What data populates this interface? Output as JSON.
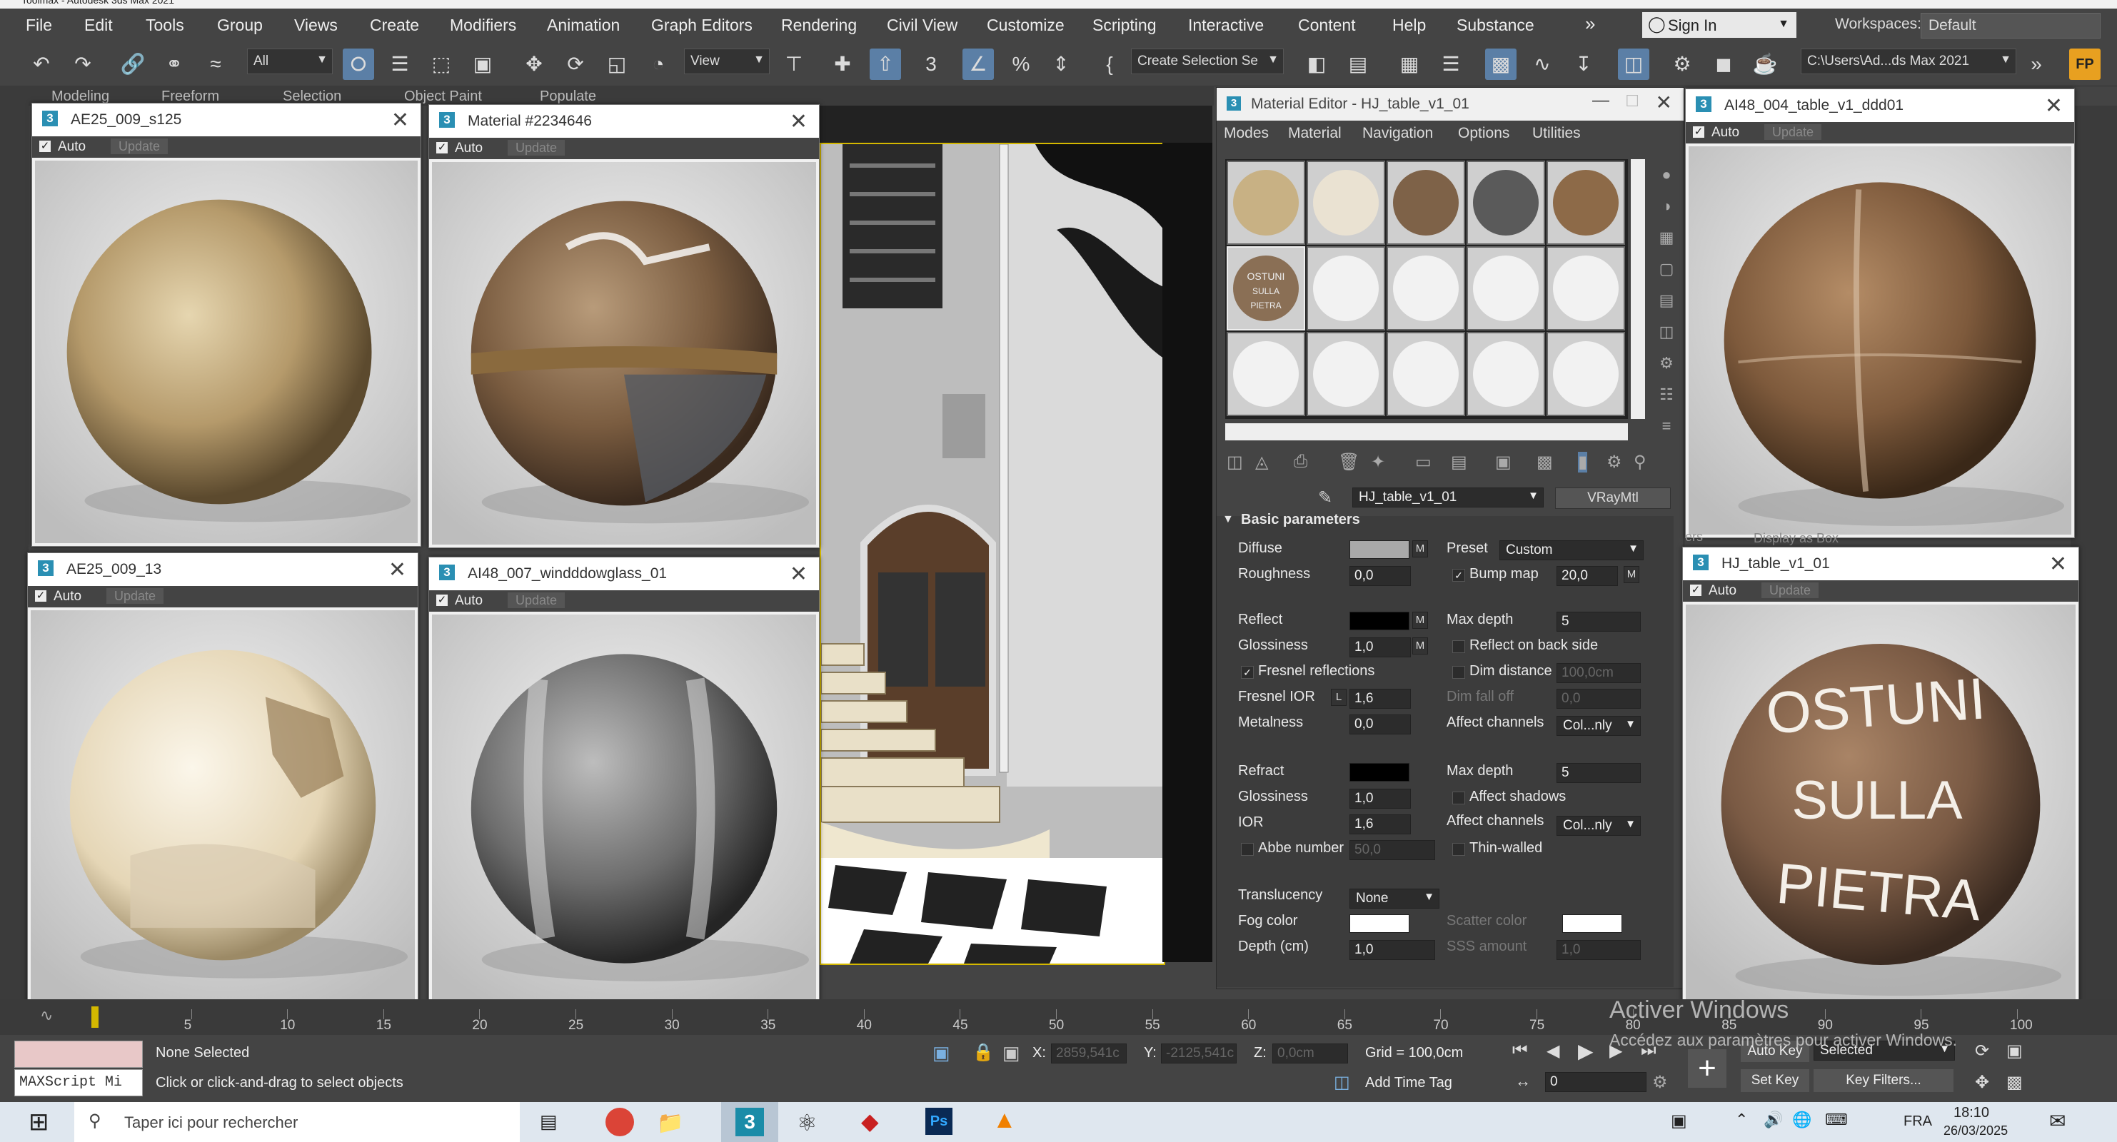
{
  "app": {
    "title_partial": "Toolmax - Autodesk 3ds Max 2021"
  },
  "menubar": {
    "items": [
      "File",
      "Edit",
      "Tools",
      "Group",
      "Views",
      "Create",
      "Modifiers",
      "Animation",
      "Graph Editors",
      "Rendering",
      "Civil View",
      "Customize",
      "Scripting",
      "Interactive",
      "Content",
      "Help",
      "Substance"
    ],
    "more": "»",
    "sign_in": "Sign In",
    "workspaces_label": "Workspaces:",
    "workspace_value": "Default"
  },
  "toolbar": {
    "filter": "All",
    "coord_system": "View",
    "selection_set": "Create Selection Se",
    "path": "C:\\Users\\Ad...ds Max 2021",
    "snap_3": "3",
    "percent": "%"
  },
  "ribbon": {
    "tabs": [
      "Modeling",
      "Freeform",
      "Selection",
      "Object Paint",
      "Populate"
    ]
  },
  "material_windows": [
    {
      "title": "AE25_009_s125",
      "auto": "Auto",
      "update": "Update"
    },
    {
      "title": "Material #2234646",
      "auto": "Auto",
      "update": "Update"
    },
    {
      "title": "AE25_009_13",
      "auto": "Auto",
      "update": "Update"
    },
    {
      "title": "AI48_007_windddowglass_01",
      "auto": "Auto",
      "update": "Update"
    },
    {
      "title": "AI48_004_table_v1_ddd01",
      "auto": "Auto",
      "update": "Update"
    },
    {
      "title": "HJ_table_v1_01",
      "auto": "Auto",
      "update": "Update",
      "sphere_text": [
        "OSTUNI",
        "SULLA",
        "PIETRA"
      ]
    }
  ],
  "material_editor": {
    "title": "Material Editor - HJ_table_v1_01",
    "menus": [
      "Modes",
      "Material",
      "Navigation",
      "Options",
      "Utilities"
    ],
    "slot_text": [
      "OSTUNI",
      "SULLA",
      "PIETRA"
    ],
    "material_name": "HJ_table_v1_01",
    "material_type": "VRayMtl",
    "rollout": "Basic parameters",
    "diffuse": {
      "label": "Diffuse",
      "m": "M",
      "color": "#a9a9a9"
    },
    "preset": {
      "label": "Preset",
      "value": "Custom"
    },
    "roughness": {
      "label": "Roughness",
      "value": "0,0"
    },
    "bump_map": {
      "label": "Bump map",
      "value": "20,0",
      "m": "M"
    },
    "reflect": {
      "label": "Reflect",
      "color": "#000000"
    },
    "max_depth_reflect": {
      "label": "Max depth",
      "value": "5"
    },
    "glossiness_reflect": {
      "label": "Glossiness",
      "value": "1,0"
    },
    "reflect_back": {
      "label": "Reflect on back side"
    },
    "fresnel": {
      "label": "Fresnel reflections"
    },
    "dim_distance": {
      "label": "Dim distance",
      "value": "100,0cm"
    },
    "fresnel_ior": {
      "label": "Fresnel IOR",
      "l": "L",
      "value": "1,6"
    },
    "dim_falloff": {
      "label": "Dim fall off",
      "value": "0,0"
    },
    "metalness": {
      "label": "Metalness",
      "value": "0,0"
    },
    "affect_channels_1": {
      "label": "Affect channels",
      "value": "Col...nly"
    },
    "refract": {
      "label": "Refract",
      "color": "#000000"
    },
    "max_depth_refract": {
      "label": "Max depth",
      "value": "5"
    },
    "glossiness_refract": {
      "label": "Glossiness",
      "value": "1,0"
    },
    "affect_shadows": {
      "label": "Affect shadows"
    },
    "ior": {
      "label": "IOR",
      "value": "1,6"
    },
    "affect_channels_2": {
      "label": "Affect channels",
      "value": "Col...nly"
    },
    "abbe": {
      "label": "Abbe number",
      "value": "50,0"
    },
    "thin_walled": {
      "label": "Thin-walled"
    },
    "translucency": {
      "label": "Translucency",
      "value": "None"
    },
    "fog_color": {
      "label": "Fog color",
      "color": "#ffffff"
    },
    "scatter_color": {
      "label": "Scatter color",
      "color": "#ffffff"
    },
    "depth": {
      "label": "Depth (cm)",
      "value": "1,0"
    },
    "sss_amount": {
      "label": "SSS amount",
      "value": "1,0"
    }
  },
  "behind_window": {
    "display_as_box": "Display as Box",
    "frag": "ers"
  },
  "timeline": {
    "ticks": [
      "5",
      "10",
      "15",
      "20",
      "25",
      "30",
      "35",
      "40",
      "45",
      "50",
      "55",
      "60",
      "65",
      "70",
      "75",
      "80",
      "85",
      "90",
      "95",
      "100"
    ]
  },
  "status": {
    "maxscript": "MAXScript Mi",
    "none_selected": "None Selected",
    "prompt": "Click or click-and-drag to select objects",
    "x_label": "X:",
    "x_value": "2859,541c",
    "y_label": "Y:",
    "y_value": "-2125,541c",
    "z_label": "Z:",
    "z_value": "0,0cm",
    "grid": "Grid = 100,0cm",
    "add_time_tag": "Add Time Tag",
    "auto_key": "Auto Key",
    "selected": "Selected",
    "set_key": "Set Key",
    "key_filters": "Key Filters...",
    "frame": "0"
  },
  "watermark": {
    "line1": "Activer Windows",
    "line2": "Accédez aux paramètres pour activer Windows."
  },
  "taskbar": {
    "search": "Taper ici pour rechercher",
    "lang": "FRA",
    "time": "18:10",
    "date": "26/03/2025"
  }
}
